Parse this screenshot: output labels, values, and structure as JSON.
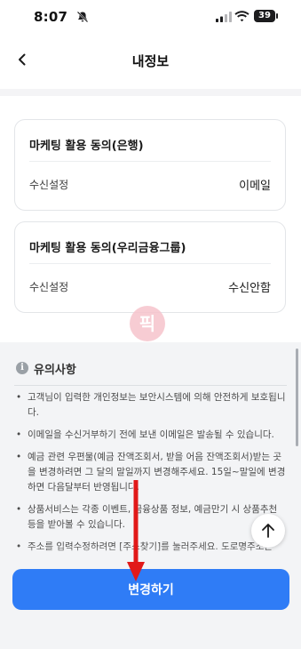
{
  "status_bar": {
    "time": "8:07",
    "battery": "39"
  },
  "header": {
    "title": "내정보"
  },
  "cards": [
    {
      "title": "마케팅 활용 동의(은행)",
      "label": "수신설정",
      "value": "이메일"
    },
    {
      "title": "마케팅 활용 동의(우리금융그룹)",
      "label": "수신설정",
      "value": "수신안함"
    }
  ],
  "watermark": "픽",
  "notice": {
    "title": "유의사항",
    "items": [
      "고객님이 입력한 개인정보는 보안시스템에 의해 안전하게 보호됩니다.",
      "이메일을 수신거부하기 전에 보낸 이메일은 발송될 수 있습니다.",
      "예금 관련 우편물(예금 잔액조회서, 받을 어음 잔액조회서)받는 곳을 변경하려면 그 달의 말일까지 변경해주세요. 15일~말일에 변경하면 다음달부터 반영됩니다.",
      "상품서비스는 각종 이벤트, 금융상품 정보, 예금만기 시 상품추천 등을 받아볼 수 있습니다.",
      "주소를 입력수정하려면 [주소찾기]를 눌러주세요. 도로명주소는"
    ]
  },
  "cta": {
    "label": "변경하기"
  },
  "colors": {
    "accent": "#2f7cf6",
    "annotation_arrow": "#e11919"
  },
  "icons": [
    "back-chevron-icon",
    "info-icon",
    "arrow-up-icon",
    "bell-slash-icon",
    "signal-icon",
    "wifi-icon",
    "battery-icon"
  ]
}
